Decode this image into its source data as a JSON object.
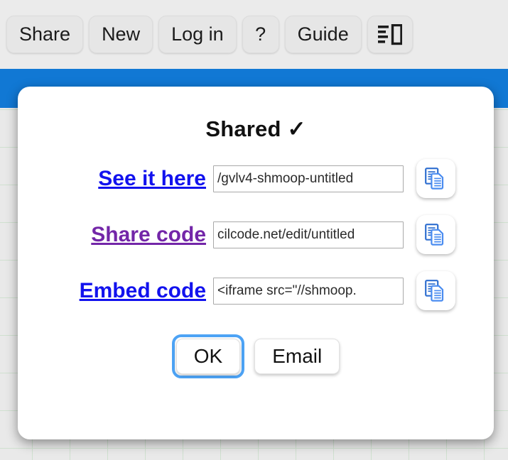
{
  "toolbar": {
    "buttons": [
      {
        "label": "Share",
        "name": "share-button"
      },
      {
        "label": "New",
        "name": "new-button"
      },
      {
        "label": "Log in",
        "name": "login-button"
      },
      {
        "label": "?",
        "name": "help-button"
      },
      {
        "label": "Guide",
        "name": "guide-button"
      }
    ],
    "layout_button": {
      "label": "",
      "icon": "layout-panel-icon"
    }
  },
  "colors": {
    "accent_bar": "#1178d4",
    "link_blue": "#1212ee",
    "link_purple": "#7326a8",
    "focus_ring": "#4da3f5",
    "copy_icon": "#2f6fd0"
  },
  "dialog": {
    "title": "Shared ✓",
    "rows": [
      {
        "label": "See it here",
        "label_state": "link-blue",
        "value": "/gvlv4-shmoop-untitled",
        "placeholder": "",
        "copy_icon": "copy-icon"
      },
      {
        "label": "Share code",
        "label_state": "link-purple",
        "value": "cilcode.net/edit/untitled",
        "placeholder": "",
        "copy_icon": "copy-icon"
      },
      {
        "label": "Embed code",
        "label_state": "link-blue",
        "value": "<iframe src=\"//shmoop.",
        "placeholder": "",
        "copy_icon": "copy-icon"
      }
    ],
    "ok_label": "OK",
    "email_label": "Email"
  }
}
